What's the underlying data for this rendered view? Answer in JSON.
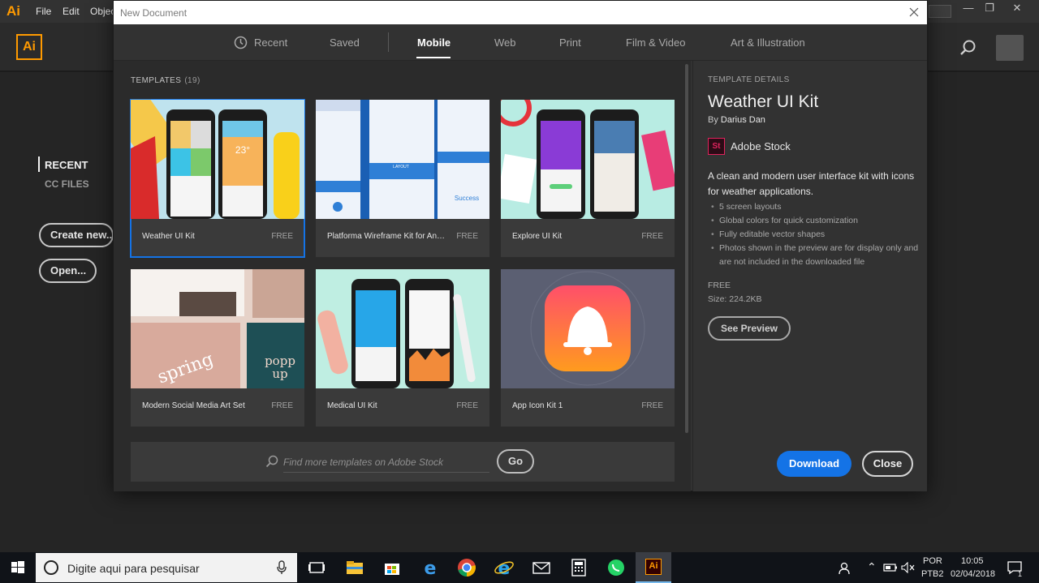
{
  "app": {
    "logo_small": "Ai",
    "logo_big": "Ai",
    "menu": [
      "File",
      "Edit",
      "Objec"
    ],
    "sidebar": {
      "recent": "RECENT",
      "cc_files": "CC FILES"
    },
    "create_new": "Create new...",
    "open": "Open..."
  },
  "dialog": {
    "title": "New Document",
    "tabs": [
      {
        "label": "Recent",
        "icon": "clock-icon"
      },
      {
        "label": "Saved"
      },
      {
        "label": "Mobile",
        "active": true
      },
      {
        "label": "Web"
      },
      {
        "label": "Print"
      },
      {
        "label": "Film & Video"
      },
      {
        "label": "Art & Illustration"
      }
    ],
    "templates_label": "TEMPLATES",
    "templates_count": "(19)",
    "templates": [
      {
        "name": "Weather UI Kit",
        "price": "FREE",
        "selected": true
      },
      {
        "name": "Platforma Wireframe Kit for Andr...",
        "price": "FREE"
      },
      {
        "name": "Explore UI Kit",
        "price": "FREE"
      },
      {
        "name": "Modern Social Media Art Set",
        "price": "FREE"
      },
      {
        "name": "Medical UI Kit",
        "price": "FREE"
      },
      {
        "name": "App Icon Kit 1",
        "price": "FREE"
      }
    ],
    "search": {
      "placeholder": "Find more templates on Adobe Stock",
      "go": "Go"
    },
    "details": {
      "label": "TEMPLATE DETAILS",
      "title": "Weather UI Kit",
      "by": "By",
      "author": "Darius Dan",
      "stock_badge": "St",
      "source": "Adobe Stock",
      "description": "A clean and modern user interface kit with icons for weather applications.",
      "bullets": [
        "5 screen layouts",
        "Global colors for quick customization",
        "Fully editable vector shapes",
        "Photos shown in the preview are for display only and are not included in the downloaded file"
      ],
      "price": "FREE",
      "size": "Size: 224.2KB",
      "see_preview": "See Preview",
      "download": "Download",
      "close": "Close"
    }
  },
  "taskbar": {
    "search_text": "Digite aqui para pesquisar",
    "lang_top": "POR",
    "lang_bottom": "PTB2",
    "time": "10:05",
    "date": "02/04/2018",
    "notification_count": "1"
  },
  "colors": {
    "accent": "#1473e6",
    "ai_orange": "#ff9a00",
    "stock_pink": "#e0245e"
  }
}
